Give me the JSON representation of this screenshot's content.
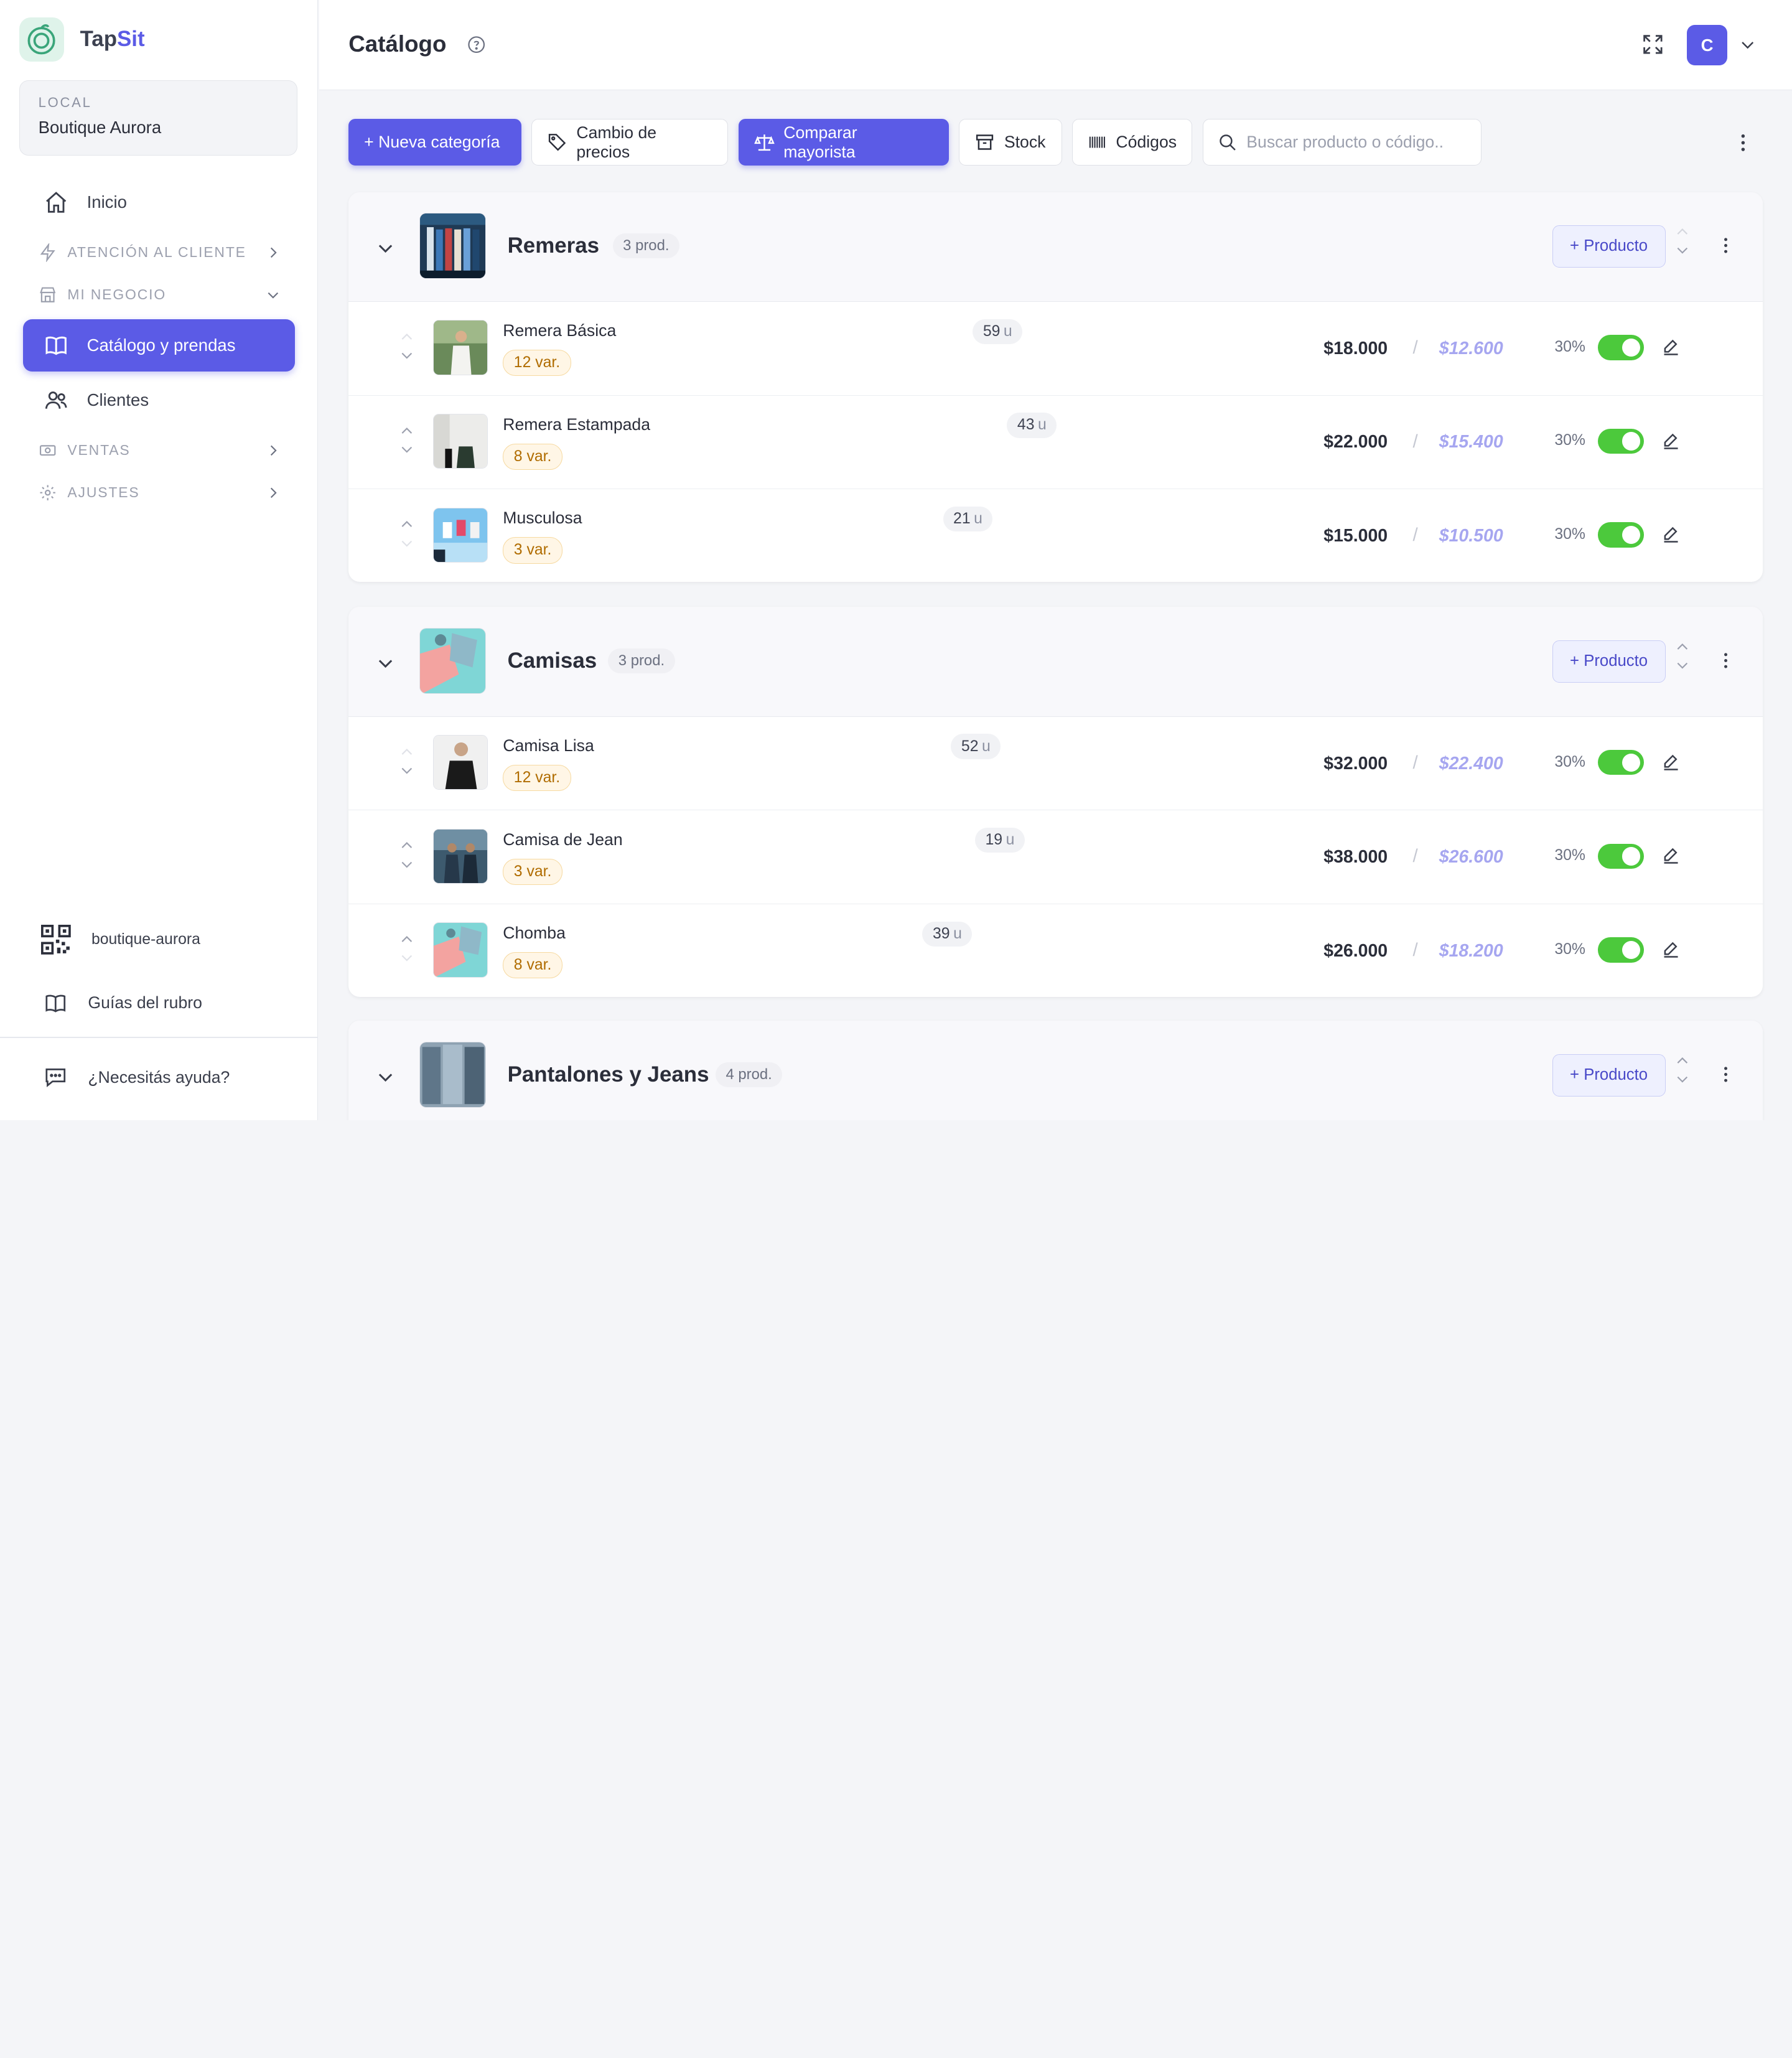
{
  "brand": {
    "name_a": "Tap",
    "name_b": "Sit"
  },
  "local": {
    "label": "LOCAL",
    "name": "Boutique Aurora"
  },
  "nav": {
    "inicio": "Inicio",
    "atencion": "ATENCIÓN AL CLIENTE",
    "negocio": "MI NEGOCIO",
    "catalogo": "Catálogo y prendas",
    "clientes": "Clientes",
    "ventas": "VENTAS",
    "ajustes": "AJUSTES",
    "qr_slug": "boutique-aurora",
    "guias": "Guías del rubro",
    "ayuda": "¿Necesitás ayuda?"
  },
  "header": {
    "title": "Catálogo",
    "avatar_initial": "C"
  },
  "toolbar": {
    "nueva_categoria": "+ Nueva categoría",
    "cambio_precios": "Cambio de precios",
    "comparar_mayorista": "Comparar mayorista",
    "stock": "Stock",
    "codigos": "Códigos",
    "search_placeholder": "Buscar producto o código.."
  },
  "add_product_label": "+ Producto",
  "categories": [
    {
      "name": "Remeras",
      "count": "3 prod.",
      "products": [
        {
          "name": "Remera Básica",
          "units": "59",
          "unit_suffix": "u",
          "variants": "12 var.",
          "price": "$18.000",
          "wholesale": "$12.600",
          "discount": "30%",
          "active": true
        },
        {
          "name": "Remera Estampada",
          "units": "43",
          "unit_suffix": "u",
          "variants": "8 var.",
          "price": "$22.000",
          "wholesale": "$15.400",
          "discount": "30%",
          "active": true
        },
        {
          "name": "Musculosa",
          "units": "21",
          "unit_suffix": "u",
          "variants": "3 var.",
          "price": "$15.000",
          "wholesale": "$10.500",
          "discount": "30%",
          "active": true
        }
      ]
    },
    {
      "name": "Camisas",
      "count": "3 prod.",
      "products": [
        {
          "name": "Camisa Lisa",
          "units": "52",
          "unit_suffix": "u",
          "variants": "12 var.",
          "price": "$32.000",
          "wholesale": "$22.400",
          "discount": "30%",
          "active": true
        },
        {
          "name": "Camisa de Jean",
          "units": "19",
          "unit_suffix": "u",
          "variants": "3 var.",
          "price": "$38.000",
          "wholesale": "$26.600",
          "discount": "30%",
          "active": true
        },
        {
          "name": "Chomba",
          "units": "39",
          "unit_suffix": "u",
          "variants": "8 var.",
          "price": "$26.000",
          "wholesale": "$18.200",
          "discount": "30%",
          "active": true
        }
      ]
    },
    {
      "name": "Pantalones y Jeans",
      "count": "4 prod.",
      "products": []
    }
  ],
  "colors": {
    "accent": "#5b5be6",
    "toggle_on": "#4cc93c",
    "variant_text": "#b06c00"
  },
  "icons": [
    "home-icon",
    "bolt-icon",
    "store-icon",
    "book-icon",
    "users-icon",
    "cash-icon",
    "gear-icon",
    "qr-icon",
    "chat-icon",
    "help-icon",
    "expand-icon",
    "tag-icon",
    "scale-icon",
    "archive-icon",
    "barcode-icon",
    "search-icon",
    "kebab-icon",
    "edit-icon"
  ]
}
